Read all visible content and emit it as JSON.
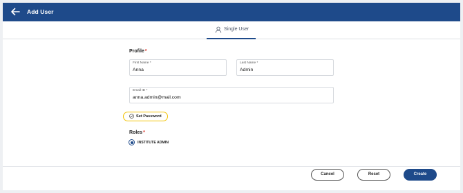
{
  "header": {
    "title": "Add User",
    "back_icon": "arrow-left-icon"
  },
  "tabs": [
    {
      "label": "Single User",
      "icon": "user-icon",
      "active": true
    }
  ],
  "profile": {
    "section_label": "Profile",
    "required_mark": "*",
    "first_name": {
      "label": "First Name *",
      "value": "Anna"
    },
    "last_name": {
      "label": "Last Name *",
      "value": "Admin"
    },
    "email": {
      "label": "Email ID *",
      "value": "anna.admin@mail.com"
    }
  },
  "set_password": {
    "label": "Set Password",
    "icon": "check-circle-icon"
  },
  "roles": {
    "section_label": "Roles",
    "required_mark": "*",
    "options": [
      {
        "label": "INSTITUTE ADMIN",
        "selected": true
      }
    ]
  },
  "footer": {
    "cancel_label": "Cancel",
    "reset_label": "Reset",
    "create_label": "Create"
  },
  "colors": {
    "brand": "#1e4a8a",
    "highlight": "#f2c200",
    "required": "#d93025"
  }
}
